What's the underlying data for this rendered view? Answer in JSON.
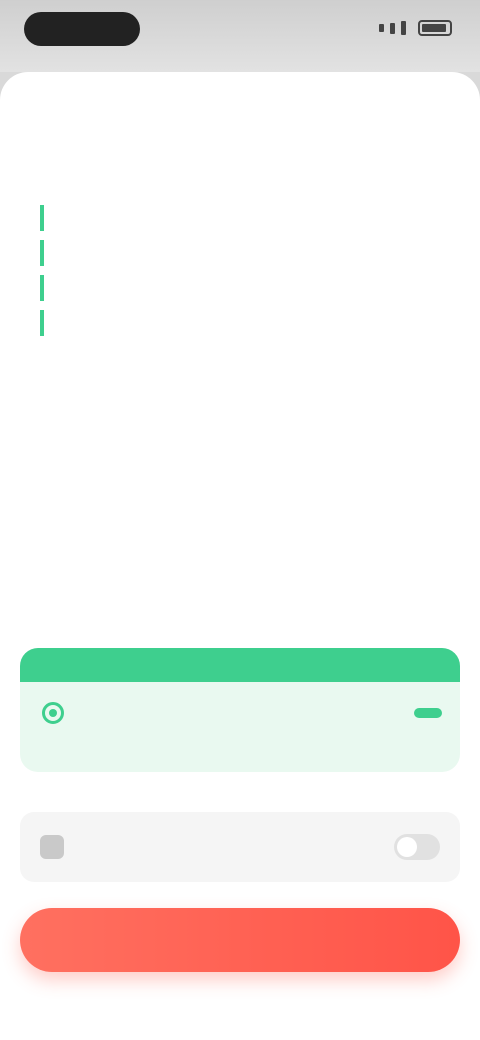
{
  "colors": {
    "accent": "#3ecf8e",
    "cta": "#ff5448"
  },
  "title": "",
  "features": [
    "",
    "",
    "",
    ""
  ],
  "plans": {
    "monthly": {
      "name": "",
      "sub": "",
      "price": ""
    },
    "yearly": {
      "banner": "",
      "banner_right": "",
      "name": "",
      "sub": "",
      "price": "",
      "badge": ""
    }
  },
  "trial": {
    "label": ""
  },
  "cta": {
    "label": ""
  },
  "footer": {
    "note": ""
  },
  "icons": {
    "check": "check-icon",
    "radio": "radio-icon",
    "toggle": "toggle-icon"
  }
}
